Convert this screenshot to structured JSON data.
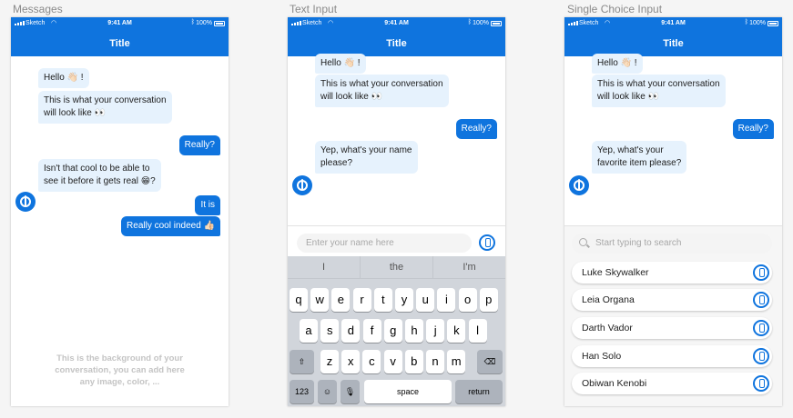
{
  "boards": {
    "messages": "Messages",
    "text_input": "Text Input",
    "single_choice": "Single Choice Input"
  },
  "status": {
    "carrier": "Sketch",
    "time": "9:41 AM",
    "battery": "100%"
  },
  "nav_title": "Title",
  "messages": {
    "hello": "Hello 👋🏻 !",
    "conv_line1": "This is what your conversation",
    "conv_line2": "will look like 👀",
    "really": "Really?",
    "cool_line1": "Isn't that cool to be able to",
    "cool_line2": "see it before it gets real 😁?",
    "it_is": "It is",
    "really_cool": "Really cool indeed 👍🏻",
    "bg_note_1": "This is the background of your",
    "bg_note_2": "conversation, you can add here",
    "bg_note_3": "any image, color, ..."
  },
  "text_input": {
    "ask_line1": "Yep, what's your name",
    "ask_line2": "please?",
    "placeholder": "Enter your name here",
    "suggestions": [
      "I",
      "the",
      "I'm"
    ],
    "row1": [
      "q",
      "w",
      "e",
      "r",
      "t",
      "y",
      "u",
      "i",
      "o",
      "p"
    ],
    "row2": [
      "a",
      "s",
      "d",
      "f",
      "g",
      "h",
      "j",
      "k",
      "l"
    ],
    "row3": [
      "z",
      "x",
      "c",
      "v",
      "b",
      "n",
      "m"
    ],
    "numbers_key": "123",
    "space_key": "space",
    "return_key": "return"
  },
  "single_choice": {
    "ask_line1": "Yep, what's your",
    "ask_line2": "favorite item please?",
    "search_placeholder": "Start typing to search",
    "options": [
      "Luke Skywalker",
      "Leia Organa",
      "Darth Vador",
      "Han Solo",
      "Obiwan Kenobi"
    ]
  },
  "colors": {
    "accent": "#0f74de",
    "incoming_bubble": "#e6f2fd",
    "keyboard": "#d1d5db"
  },
  "icons": [
    "signal-icon",
    "wifi-icon",
    "bluetooth-icon",
    "battery-icon",
    "rebel-avatar-icon",
    "mic-icon",
    "search-icon",
    "emoji-icon",
    "shift-icon",
    "backspace-icon"
  ]
}
